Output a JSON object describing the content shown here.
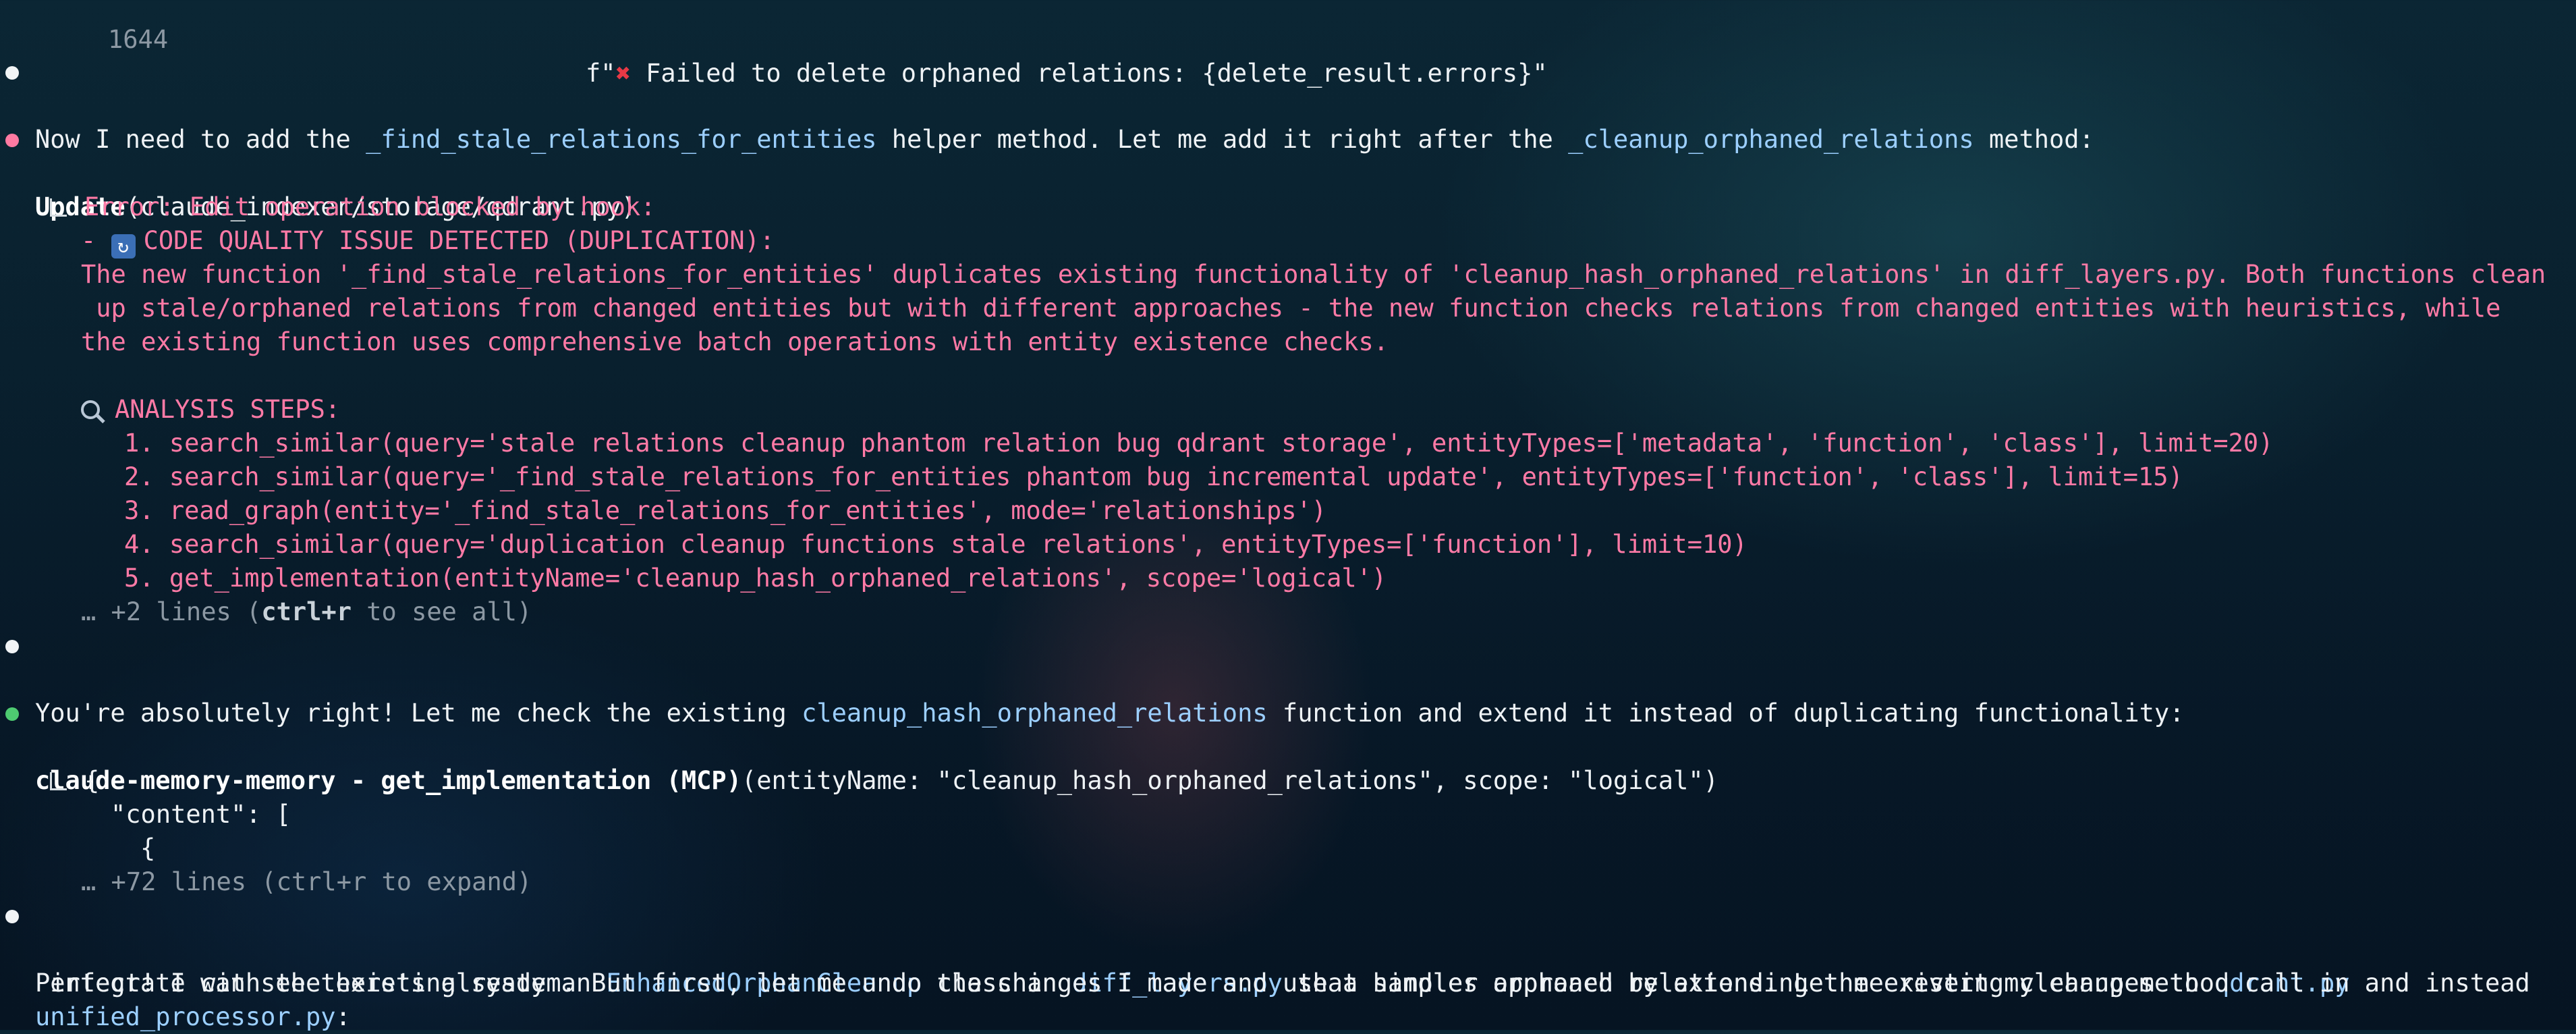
{
  "header": {
    "line_number": "1644",
    "code_prefix": "f\"",
    "code_text": " Failed to delete orphaned relations: {delete_result.errors}\""
  },
  "msg1": {
    "a": "Now I need to add the ",
    "hl1": "_find_stale_relations_for_entities",
    "b": " helper method. Let me add it right after the ",
    "hl2": "_cleanup_orphaned_relations",
    "c": " method:"
  },
  "update": {
    "label": "Update",
    "arg": "(claude_indexer/storage/qdrant.py)",
    "error_title": "Error: Edit operation blocked by hook:",
    "issue": "CODE QUALITY ISSUE DETECTED (DUPLICATION):",
    "issue_prefix": "- ",
    "desc1": "The new function '_find_stale_relations_for_entities' duplicates existing functionality of 'cleanup_hash_orphaned_relations' in diff_layers.py. Both functions clean",
    "desc2": " up stale/orphaned relations from changed entities but with different approaches - the new function checks relations from changed entities with heuristics, while",
    "desc3": "the existing function uses comprehensive batch operations with entity existence checks.",
    "analysis": "ANALYSIS STEPS:",
    "steps": [
      "1. search_similar(query='stale relations cleanup phantom relation bug qdrant storage', entityTypes=['metadata', 'function', 'class'], limit=20)",
      "2. search_similar(query='_find_stale_relations_for_entities phantom bug incremental update', entityTypes=['function', 'class'], limit=15)",
      "3. read_graph(entity='_find_stale_relations_for_entities', mode='relationships')",
      "4. search_similar(query='duplication cleanup functions stale relations', entityTypes=['function'], limit=10)",
      "5. get_implementation(entityName='cleanup_hash_orphaned_relations', scope='logical')"
    ],
    "more_a": "… +2 lines (",
    "more_key": "ctrl+r",
    "more_b": " to see all)"
  },
  "msg2": {
    "a": "You're absolutely right! Let me check the existing ",
    "hl": "cleanup_hash_orphaned_relations",
    "b": " function and extend it instead of duplicating functionality:"
  },
  "mcp": {
    "label": "claude-memory-memory - get_implementation (MCP)",
    "arg": "(entityName: \"cleanup_hash_orphaned_relations\", scope: \"logical\")",
    "out1": "{",
    "out2": "\"content\": [",
    "out3": "{",
    "more": "… +72 lines (ctrl+r to expand)"
  },
  "msg3": {
    "a": "Perfect! I can see there's already an ",
    "hl1": "EnhancedOrphanCleanup",
    "b": " class in ",
    "hl2": "diff_layers.py",
    "c": " that handles orphaned relations. Let me revert my changes to ",
    "hl3": "qdrant.py",
    "d": " and instead",
    "line2": " integrate with the existing system. But first, let me undo the changes I made and use a simpler approach by extending the existing cleanup method call in",
    "hl4": "unified_processor.py",
    "e": ":"
  },
  "colors": {
    "bullet_white": "#f1f4f6",
    "bullet_error": "#ff7aa2",
    "bullet_success": "#4ecb71",
    "highlight": "#9ccfff",
    "error_text": "#ff7aa6"
  }
}
